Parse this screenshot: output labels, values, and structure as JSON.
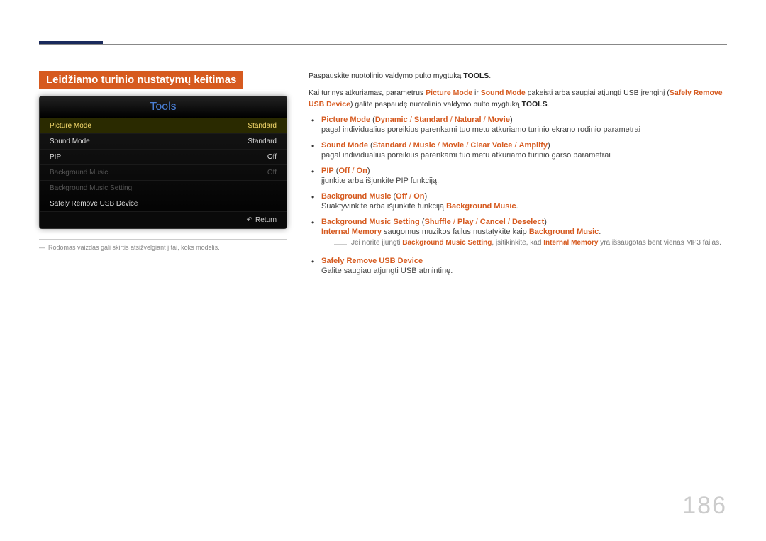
{
  "page_number": "186",
  "section_title": "Leidžiamo turinio nustatymų keitimas",
  "tools_panel": {
    "title": "Tools",
    "rows": [
      {
        "label": "Picture Mode",
        "value": "Standard",
        "state": "selected"
      },
      {
        "label": "Sound Mode",
        "value": "Standard",
        "state": "normal"
      },
      {
        "label": "PIP",
        "value": "Off",
        "state": "normal"
      },
      {
        "label": "Background Music",
        "value": "Off",
        "state": "dim"
      },
      {
        "label": "Background Music Setting",
        "value": "",
        "state": "dim"
      },
      {
        "label": "Safely Remove USB Device",
        "value": "",
        "state": "normal"
      }
    ],
    "footer_icon": "↶",
    "footer_label": "Return"
  },
  "footnote_dash": "―",
  "footnote_text": "Rodomas vaizdas gali skirtis atsižvelgiant į tai, koks modelis.",
  "intro": {
    "p1_prefix": "Paspauskite nuotolinio valdymo pulto mygtuką ",
    "p1_bold": "TOOLS",
    "p1_suffix": ".",
    "p2_a": "Kai turinys atkuriamas, parametrus ",
    "p2_pm": "Picture Mode",
    "p2_b": " ir ",
    "p2_sm": "Sound Mode",
    "p2_c": " pakeisti arba saugiai atjungti USB įrenginį (",
    "p2_sr": "Safely Remove USB Device",
    "p2_d": ") galite paspaudę nuotolinio valdymo pulto mygtuką ",
    "p2_tools": "TOOLS",
    "p2_e": "."
  },
  "items": [
    {
      "title_parts": [
        "Picture Mode",
        " (",
        "Dynamic",
        " / ",
        "Standard",
        " / ",
        "Natural",
        " / ",
        "Movie",
        ")"
      ],
      "desc": "pagal individualius poreikius parenkami tuo metu atkuriamo turinio ekrano rodinio parametrai"
    },
    {
      "title_parts": [
        "Sound Mode",
        " (",
        "Standard",
        " / ",
        "Music",
        " / ",
        "Movie",
        " / ",
        "Clear Voice",
        " / ",
        "Amplify",
        ")"
      ],
      "desc": "pagal individualius poreikius parenkami tuo metu atkuriamo turinio garso parametrai"
    },
    {
      "title_parts": [
        "PIP",
        " (",
        "Off",
        " / ",
        "On",
        ")"
      ],
      "desc": "įjunkite arba išjunkite PIP funkciją."
    },
    {
      "title_parts": [
        "Background Music",
        " (",
        "Off",
        " / ",
        "On",
        ")"
      ],
      "desc_pre": "Suaktyvinkite arba išjunkite funkciją ",
      "desc_hl": "Background Music",
      "desc_post": "."
    },
    {
      "title_parts": [
        "Background Music Setting",
        " (",
        "Shuffle",
        " / ",
        "Play",
        " / ",
        "Cancel",
        " / ",
        "Deselect",
        ")"
      ],
      "line2_a": "Internal Memory",
      "line2_b": " saugomus muzikos failus nustatykite kaip ",
      "line2_c": "Background Music",
      "line2_d": ".",
      "note_dash": "―",
      "note_a": "Jei norite įjungti ",
      "note_b": "Background Music Setting",
      "note_c": ", įsitikinkite, kad ",
      "note_d": "Internal Memory",
      "note_e": " yra išsaugotas bent vienas MP3 failas."
    },
    {
      "title_parts": [
        "Safely Remove USB Device"
      ],
      "desc": "Galite saugiau atjungti USB atmintinę."
    }
  ]
}
